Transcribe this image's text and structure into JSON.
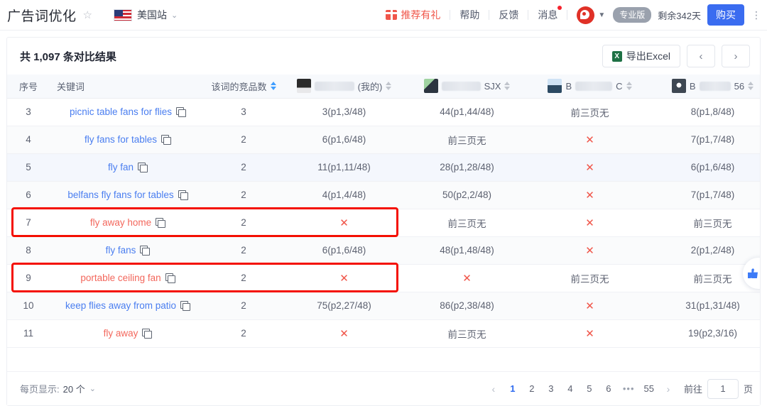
{
  "header": {
    "title": "广告词优化",
    "star_icon": "star-icon",
    "site": {
      "name": "美国站",
      "flag_icon": "us-flag-icon",
      "caret_icon": "chevron-down-icon"
    },
    "gift_link": "推荐有礼",
    "nav": [
      {
        "label": "帮助"
      },
      {
        "label": "反馈"
      },
      {
        "label": "消息",
        "badge": true
      }
    ],
    "account": {
      "avatar_icon": "user-avatar-icon",
      "caret_icon": "chevron-down-icon"
    },
    "plan_badge": "专业版",
    "days_left": "剩余342天",
    "buy_label": "购买"
  },
  "toolbar": {
    "result_count": "共 1,097 条对比结果",
    "export_label": "导出Excel",
    "export_icon": "excel-icon",
    "prev_icon": "chevron-left-icon",
    "next_icon": "chevron-right-icon"
  },
  "table": {
    "columns": [
      {
        "key": "idx",
        "label": "序号",
        "sortable": false,
        "align": "center"
      },
      {
        "key": "kw",
        "label": "关键词",
        "sortable": false,
        "align": "left"
      },
      {
        "key": "comp",
        "label": "该词的竞品数",
        "sortable": true,
        "align": "center"
      },
      {
        "key": "p1",
        "label": "(我的)",
        "blurred": true,
        "thumb": "product-thumb-1",
        "sortable": true,
        "align": "center"
      },
      {
        "key": "p2",
        "label": "SJX",
        "blurred": true,
        "thumb": "product-thumb-2",
        "sortable": true,
        "align": "center"
      },
      {
        "key": "p3",
        "label": "C",
        "prefix": "B",
        "blurred": true,
        "thumb": "product-thumb-3",
        "sortable": true,
        "align": "center"
      },
      {
        "key": "p4",
        "label": "56",
        "prefix": "B",
        "blurred": true,
        "thumb": "product-thumb-4",
        "sortable": true,
        "align": "center"
      }
    ],
    "rows": [
      {
        "idx": "3",
        "kw": "picnic table fans for flies",
        "comp": "3",
        "p1": "3(p1,3/48)",
        "p2": "44(p1,44/48)",
        "p3": "前三页无",
        "p4": "8(p1,8/48)",
        "alert": false,
        "stripe": false,
        "hover": false,
        "highlight": false
      },
      {
        "idx": "4",
        "kw": "fly fans for tables",
        "comp": "2",
        "p1": "6(p1,6/48)",
        "p2": "前三页无",
        "p3": "✕",
        "p4": "7(p1,7/48)",
        "alert": false,
        "stripe": true,
        "hover": false,
        "highlight": false
      },
      {
        "idx": "5",
        "kw": "fly fan",
        "comp": "2",
        "p1": "11(p1,11/48)",
        "p2": "28(p1,28/48)",
        "p3": "✕",
        "p4": "6(p1,6/48)",
        "alert": false,
        "stripe": false,
        "hover": true,
        "highlight": false
      },
      {
        "idx": "6",
        "kw": "belfans fly fans for tables",
        "comp": "2",
        "p1": "4(p1,4/48)",
        "p2": "50(p2,2/48)",
        "p3": "✕",
        "p4": "7(p1,7/48)",
        "alert": false,
        "stripe": true,
        "hover": false,
        "highlight": false
      },
      {
        "idx": "7",
        "kw": "fly away home",
        "comp": "2",
        "p1": "✕",
        "p2": "前三页无",
        "p3": "✕",
        "p4": "前三页无",
        "alert": true,
        "stripe": false,
        "hover": false,
        "highlight": true
      },
      {
        "idx": "8",
        "kw": "fly fans",
        "comp": "2",
        "p1": "6(p1,6/48)",
        "p2": "48(p1,48/48)",
        "p3": "✕",
        "p4": "2(p1,2/48)",
        "alert": false,
        "stripe": true,
        "hover": false,
        "highlight": false
      },
      {
        "idx": "9",
        "kw": "portable ceiling fan",
        "comp": "2",
        "p1": "✕",
        "p2": "✕",
        "p3": "前三页无",
        "p4": "前三页无",
        "alert": true,
        "stripe": false,
        "hover": false,
        "highlight": true
      },
      {
        "idx": "10",
        "kw": "keep flies away from patio",
        "comp": "2",
        "p1": "75(p2,27/48)",
        "p2": "86(p2,38/48)",
        "p3": "✕",
        "p4": "31(p1,31/48)",
        "alert": false,
        "stripe": true,
        "hover": false,
        "highlight": false
      },
      {
        "idx": "11",
        "kw": "fly away",
        "comp": "2",
        "p1": "✕",
        "p2": "前三页无",
        "p3": "✕",
        "p4": "19(p2,3/16)",
        "alert": true,
        "stripe": false,
        "hover": false,
        "highlight": false
      }
    ]
  },
  "footer": {
    "page_size_label": "每页显示:",
    "page_size_value": "20 个",
    "caret_icon": "chevron-down-icon",
    "prev_icon": "chevron-left-icon",
    "next_icon": "chevron-right-icon",
    "pages": [
      "1",
      "2",
      "3",
      "4",
      "5",
      "6",
      "•••",
      "55"
    ],
    "current_page": "1",
    "goto_label": "前往",
    "goto_value": "1",
    "goto_unit": "页"
  },
  "float_widget": {
    "icon": "thumbs-up-icon"
  },
  "colors": {
    "link": "#4a7ef0",
    "alert": "#f3675c",
    "highlight_box": "#f40f02",
    "primary": "#3a6cf0",
    "brand_red": "#e03127"
  }
}
